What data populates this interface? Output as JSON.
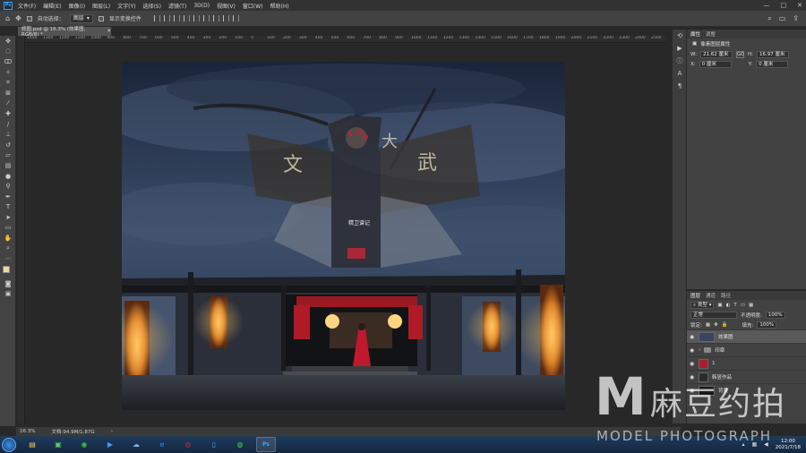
{
  "menubar": {
    "logo": "Ps",
    "items": [
      "文件(F)",
      "编辑(E)",
      "图像(I)",
      "图层(L)",
      "文字(Y)",
      "选择(S)",
      "滤镜(T)",
      "3D(D)",
      "视图(V)",
      "窗口(W)",
      "帮助(H)"
    ],
    "controls": [
      "—",
      "□",
      "✕"
    ]
  },
  "options": {
    "auto_select_label": "自动选择：",
    "auto_select_value": "图层",
    "show_transform_label": "显示变换控件"
  },
  "document": {
    "tab_label": "修图.psd @ 16.3% (效果图, RGB/8) *",
    "tab_close": "✕",
    "zoom": "16.3%",
    "doc_info": "文档:94.9M/1.87G"
  },
  "ruler": {
    "top_labels": [
      "1400",
      "1300",
      "1200",
      "1100",
      "1000",
      "900",
      "800",
      "700",
      "600",
      "500",
      "400",
      "300",
      "200",
      "100",
      "0",
      "100",
      "200",
      "300",
      "400",
      "500",
      "600",
      "700",
      "800",
      "900",
      "1000",
      "1100",
      "1200",
      "1300",
      "1400",
      "1500",
      "1600",
      "1700",
      "1800",
      "1900",
      "2000",
      "2100",
      "2200",
      "2300",
      "2400",
      "2500"
    ]
  },
  "properties": {
    "tabs": [
      "属性",
      "调整"
    ],
    "title": "像素图层属性",
    "w_label": "W:",
    "w_value": "21.62 厘米",
    "h_label": "H:",
    "h_value": "16.97 厘米",
    "x_label": "X:",
    "x_value": "0 厘米",
    "y_label": "Y:",
    "y_value": "0 厘米",
    "link": "GO"
  },
  "layers": {
    "tabs": [
      "图层",
      "通道",
      "路径"
    ],
    "filter_value": "类型",
    "blend_mode": "正常",
    "opacity_label": "不透明度:",
    "opacity_value": "100%",
    "lock_label": "锁定:",
    "fill_label": "填充:",
    "fill_value": "100%",
    "rows": [
      {
        "name": "效果图"
      },
      {
        "name": "印章"
      },
      {
        "name": "1"
      },
      {
        "name": "韩昱作品"
      },
      {
        "name": "背景"
      }
    ]
  },
  "taskbar": {
    "time": "12:00",
    "date": "2021/7/18"
  },
  "watermark": {
    "letter": "M",
    "cn": "麻豆约拍",
    "en": "MODEL PHOTOGRAPH"
  },
  "artwork": {
    "banner_left": "文",
    "banner_right": "武",
    "banner_mid": "大",
    "seal_text": "精卫谱记"
  }
}
